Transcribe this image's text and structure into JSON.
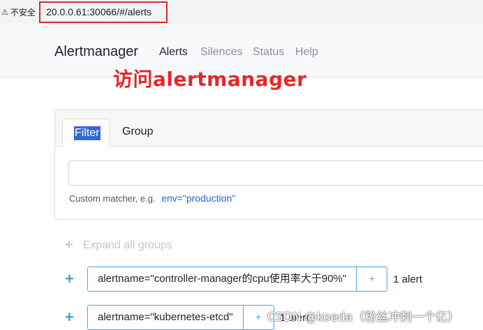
{
  "browser": {
    "security_label": "不安全",
    "url": "20.0.0.61:30066/#/alerts"
  },
  "navbar": {
    "brand": "Alertmanager",
    "links": [
      "Alerts",
      "Silences",
      "Status",
      "Help"
    ]
  },
  "annotation": "访问alertmanager",
  "filter": {
    "tabs": [
      "Filter",
      "Group"
    ],
    "input_value": "",
    "hint_text": "Custom matcher, e.g.",
    "hint_example": "env=\"production\""
  },
  "expand_all_label": "Expand all groups",
  "groups": [
    {
      "label": "alertname=\"controller-manager的cpu使用率大于90%\"",
      "count": "1 alert"
    },
    {
      "label": "alertname=\"kubernetes-etcd\"",
      "count": "1 alert"
    }
  ],
  "watermark": "CSDN @koeda（粉丝冲刺一个亿）",
  "colors": {
    "accent": "#4aa3df",
    "annotation": "#e8262b",
    "url_highlight": "#e0272a"
  }
}
